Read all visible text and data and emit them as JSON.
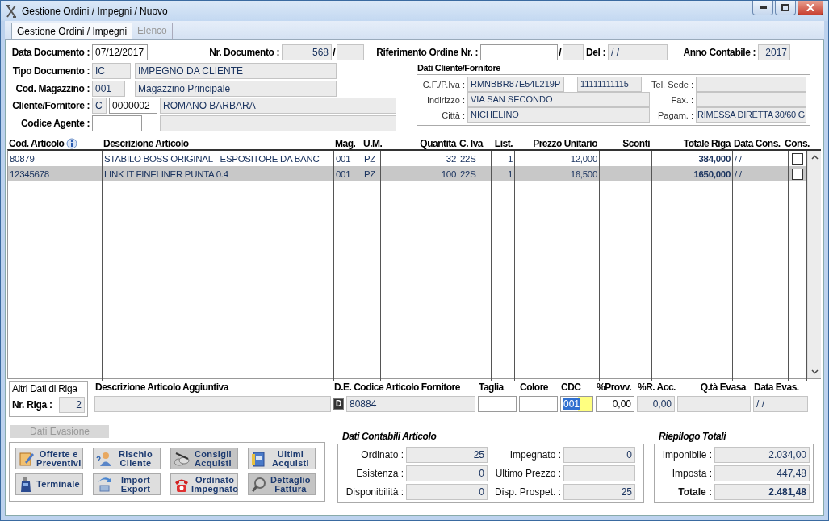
{
  "window": {
    "title": "Gestione Ordini / Impegni / Nuovo"
  },
  "tabs": [
    {
      "label": "Gestione Ordini / Impegni",
      "selected": true
    },
    {
      "label": "Elenco",
      "selected": false
    }
  ],
  "document": {
    "data_documento": {
      "label": "Data Documento :",
      "value": "07/12/2017"
    },
    "nr_documento": {
      "label": "Nr. Documento :",
      "value": "568",
      "separator": "/"
    },
    "riferimento": {
      "label": "Riferimento Ordine Nr. :",
      "separator": "/"
    },
    "del": {
      "label": "Del :",
      "value": "/ /"
    },
    "anno": {
      "label": "Anno Contabile :",
      "value": "2017"
    },
    "tipo": {
      "label": "Tipo Documento :",
      "code": "IC",
      "description": "IMPEGNO DA CLIENTE"
    },
    "magazzino": {
      "label": "Cod. Magazzino :",
      "code": "001",
      "description": "Magazzino Principale"
    },
    "cliente": {
      "label": "Cliente/Fornitore :",
      "type": "C",
      "code": "0000002",
      "description": "ROMANO BARBARA"
    },
    "agente": {
      "label": "Codice Agente :"
    }
  },
  "customer": {
    "title": "Dati Cliente/Fornitore",
    "cf_label": "C.F./P.Iva :",
    "cf": "RMNBBR87E54L219P",
    "piva": "11111111115",
    "indirizzo_label": "Indirizzo :",
    "indirizzo": "VIA SAN SECONDO",
    "citta_label": "Città :",
    "citta": "NICHELINO",
    "tel_label": "Tel. Sede :",
    "fax_label": "Fax. :",
    "pagam_label": "Pagam. :",
    "pagam": "RIMESSA DIRETTA 30/60 G"
  },
  "table": {
    "columns": [
      "Cod. Articolo",
      "Descrizione Articolo",
      "Mag.",
      "U.M.",
      "Quantità",
      "C. Iva",
      "List.",
      "Prezzo Unitario",
      "Sconti",
      "Totale Riga",
      "Data Cons.",
      "Cons."
    ],
    "rows": [
      {
        "selected": false,
        "cons": false,
        "cells": [
          "80879",
          "STABILO BOSS ORIGINAL - ESPOSITORE DA BANC",
          "001",
          "PZ",
          "32",
          "22S",
          "1",
          "12,000",
          null,
          "384,000",
          "/ /"
        ]
      },
      {
        "selected": true,
        "cons": false,
        "cells": [
          "12345678",
          "LINK IT FINELINER PUNTA 0.4",
          "001",
          "PZ",
          "100",
          "22S",
          "1",
          "16,500",
          null,
          "1650,000",
          "/ /"
        ]
      }
    ]
  },
  "row_details": {
    "title": "Altri Dati di Riga",
    "nr_label": "Nr. Riga :",
    "nr": "2",
    "fields": [
      {
        "label": "Descrizione Articolo Aggiuntiva",
        "editable": false
      },
      {
        "label": "D.E. Codice Articolo Fornitore",
        "value": "80884",
        "button": "D",
        "editable": false
      },
      {
        "label": "Taglia",
        "editable": true
      },
      {
        "label": "Colore",
        "editable": true
      },
      {
        "label": "CDC",
        "value": "001",
        "editable": true,
        "focused": true
      },
      {
        "label": "%Provv.",
        "value": "0,00",
        "editable": true
      },
      {
        "label": "%R. Acc.",
        "value": "0,00",
        "editable": false
      },
      {
        "label": "Q.tà Evasa",
        "editable": false
      },
      {
        "label": "Data Evas.",
        "value": "/ /",
        "editable": false
      }
    ]
  },
  "dati_evasione": {
    "label": "Dati Evasione",
    "disabled": true
  },
  "actions": [
    {
      "lines": [
        "Offerte e",
        "Preventivi"
      ]
    },
    {
      "lines": [
        "Rischio",
        "Cliente"
      ]
    },
    {
      "lines": [
        "Consigli",
        "Acquisti"
      ]
    },
    {
      "lines": [
        "Ultimi",
        "Acquisti"
      ]
    },
    {
      "lines": [
        "Terminale"
      ]
    },
    {
      "lines": [
        "Import",
        "Export"
      ]
    },
    {
      "lines": [
        "Ordinato",
        "Impegnato"
      ]
    },
    {
      "lines": [
        "Dettaglio",
        "Fattura"
      ]
    }
  ],
  "accounting": {
    "title": "Dati Contabili Articolo",
    "items": [
      {
        "label": "Ordinato :",
        "value": "25"
      },
      {
        "label": "Impegnato :",
        "value": "0"
      },
      {
        "label": "Esistenza :",
        "value": "0"
      },
      {
        "label": "Ultimo Prezzo :"
      },
      {
        "label": "Disponibilità :",
        "value": "0"
      },
      {
        "label": "Disp. Prospet. :",
        "value": "25"
      }
    ]
  },
  "totals": {
    "title": "Riepilogo Totali",
    "items": [
      {
        "label": "Imponibile :",
        "value": "2.034,00",
        "kind": "amount"
      },
      {
        "label": "Imposta :",
        "value": "447,48",
        "kind": "amount"
      },
      {
        "label": "Totale :",
        "value": "2.481,48",
        "kind": "total"
      }
    ]
  }
}
